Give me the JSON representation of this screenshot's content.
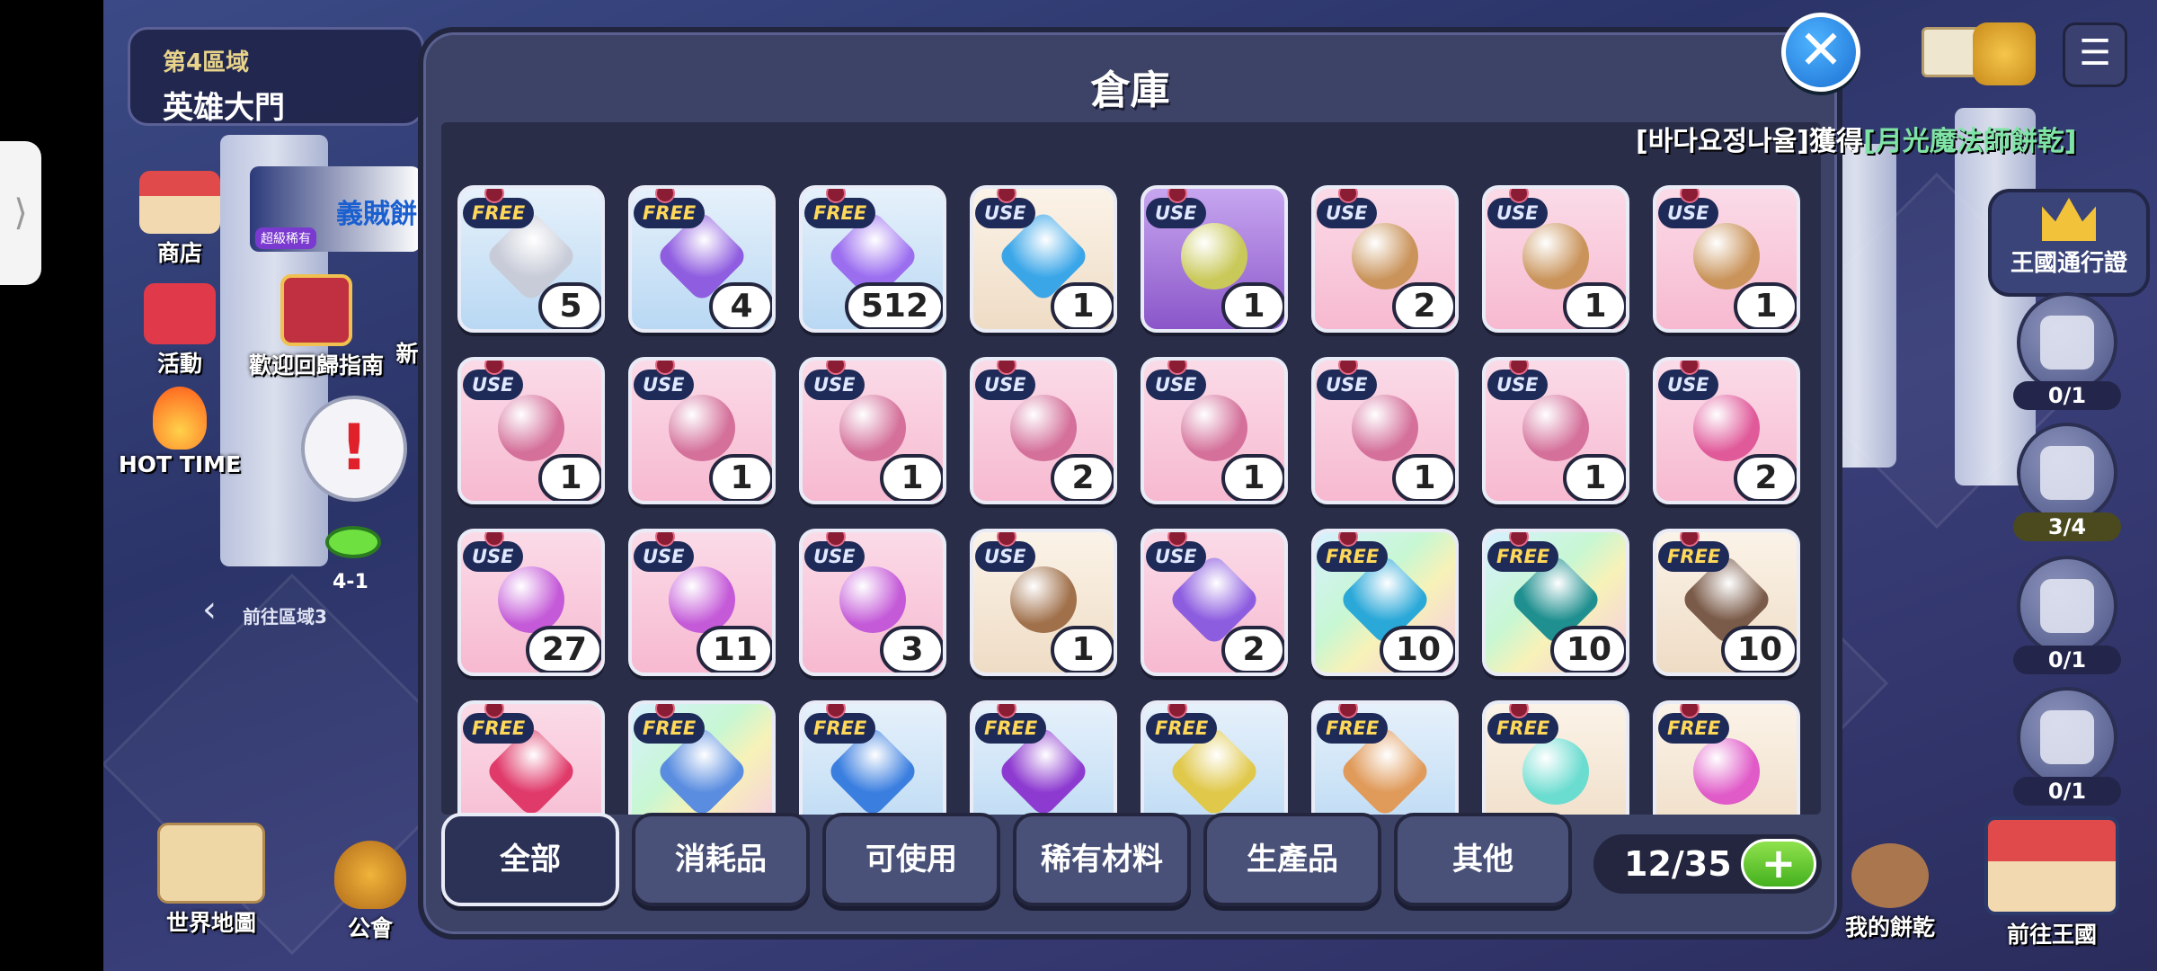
{
  "zone": {
    "subtitle": "第4區域",
    "title": "英雄大門"
  },
  "left_menu": [
    {
      "key": "shop",
      "label": "商店"
    },
    {
      "key": "event",
      "label": "活動"
    },
    {
      "key": "return_guide",
      "label": "歡迎回歸指南"
    },
    {
      "key": "hot_time",
      "label": "HOT TIME"
    }
  ],
  "banner": {
    "title": "義賊餅",
    "badge": "超級稀有"
  },
  "stage": {
    "label": "4-1",
    "prev_zone": "前往區域3",
    "partial_label": "新"
  },
  "bottom_left": {
    "world_map": "世界地圖",
    "guild": "公會"
  },
  "bottom_right": {
    "my_cookies": "我的餅乾",
    "go_kingdom": "前往王國"
  },
  "right_hud": {
    "kingdom_pass": "王國通行證",
    "counters": [
      "0/1",
      "3/4",
      "0/1",
      "0/1"
    ]
  },
  "notice": {
    "player": "[바다요정나율]",
    "verb": "獲得",
    "reward": "[月光魔法師餅乾]"
  },
  "warehouse": {
    "title": "倉庫",
    "capacity": "12/35",
    "add_label": "+",
    "close_label": "✕",
    "tabs": [
      "全部",
      "消耗品",
      "可使用",
      "稀有材料",
      "生產品",
      "其他"
    ],
    "items": [
      {
        "tag": "FREE",
        "qty": "5",
        "bg": "blue",
        "color": "#c8ccd8",
        "icon": "gingerbread-outline-icon"
      },
      {
        "tag": "FREE",
        "qty": "4",
        "bg": "blue",
        "color": "#8f5de0",
        "icon": "purple-gem-book-icon"
      },
      {
        "tag": "FREE",
        "qty": "512",
        "bg": "blue",
        "color": "#9b6ef0",
        "icon": "star-crystal-icon"
      },
      {
        "tag": "USE",
        "qty": "1",
        "bg": "cream",
        "color": "#3aa6e8",
        "icon": "level-50-star-icon"
      },
      {
        "tag": "USE",
        "qty": "1",
        "bg": "purple",
        "color": "#c9c95a",
        "icon": "legendary-chest-icon"
      },
      {
        "tag": "USE",
        "qty": "2",
        "bg": "pink",
        "color": "#c9935a",
        "icon": "cookie-chest-icon"
      },
      {
        "tag": "USE",
        "qty": "1",
        "bg": "pink",
        "color": "#c9935a",
        "icon": "cookie-chest-icon"
      },
      {
        "tag": "USE",
        "qty": "1",
        "bg": "pink",
        "color": "#c9935a",
        "icon": "cookie-chest-icon"
      },
      {
        "tag": "USE",
        "qty": "1",
        "bg": "pink",
        "color": "#d4709a",
        "icon": "cookie-chest-icon"
      },
      {
        "tag": "USE",
        "qty": "1",
        "bg": "pink",
        "color": "#d4709a",
        "icon": "cookie-chest-icon"
      },
      {
        "tag": "USE",
        "qty": "1",
        "bg": "pink",
        "color": "#d4709a",
        "icon": "cookie-chest-icon"
      },
      {
        "tag": "USE",
        "qty": "2",
        "bg": "pink",
        "color": "#d4709a",
        "icon": "cookie-chest-icon"
      },
      {
        "tag": "USE",
        "qty": "1",
        "bg": "pink",
        "color": "#d4709a",
        "icon": "cookie-chest-icon"
      },
      {
        "tag": "USE",
        "qty": "1",
        "bg": "pink",
        "color": "#d4709a",
        "icon": "cookie-chest-icon"
      },
      {
        "tag": "USE",
        "qty": "1",
        "bg": "pink",
        "color": "#d4709a",
        "icon": "cookie-chest-icon"
      },
      {
        "tag": "USE",
        "qty": "2",
        "bg": "pink",
        "color": "#e05a9a",
        "icon": "cookie-chest-icon"
      },
      {
        "tag": "USE",
        "qty": "27",
        "bg": "pink",
        "color": "#c45ad8",
        "icon": "purple-pouch-icon"
      },
      {
        "tag": "USE",
        "qty": "11",
        "bg": "pink",
        "color": "#c45ad8",
        "icon": "purple-pouch-icon"
      },
      {
        "tag": "USE",
        "qty": "3",
        "bg": "pink",
        "color": "#c45ad8",
        "icon": "purple-pouch-icon"
      },
      {
        "tag": "USE",
        "qty": "1",
        "bg": "cream",
        "color": "#a0704a",
        "icon": "brown-pouch-icon"
      },
      {
        "tag": "USE",
        "qty": "2",
        "bg": "pink",
        "color": "#8d5de0",
        "icon": "starry-card-icon"
      },
      {
        "tag": "FREE",
        "qty": "10",
        "bg": "rainbow",
        "color": "#2aa8d8",
        "icon": "water-crystal-icon"
      },
      {
        "tag": "FREE",
        "qty": "10",
        "bg": "rainbow",
        "color": "#1f8f8f",
        "icon": "emerald-crystal-icon"
      },
      {
        "tag": "FREE",
        "qty": "10",
        "bg": "cream",
        "color": "#7a5a48",
        "icon": "pendant-gem-icon"
      },
      {
        "tag": "FREE",
        "qty": "",
        "bg": "pink",
        "color": "#e03a6a",
        "icon": "red-pendant-gem-icon"
      },
      {
        "tag": "FREE",
        "qty": "",
        "bg": "rainbow",
        "color": "#5a8de0",
        "icon": "blue-pendant-gem-icon"
      },
      {
        "tag": "FREE",
        "qty": "",
        "bg": "blue",
        "color": "#3a7ee0",
        "icon": "blue-swirl-gem-icon"
      },
      {
        "tag": "FREE",
        "qty": "",
        "bg": "blue",
        "color": "#8d3ad0",
        "icon": "purple-swirl-gem-icon"
      },
      {
        "tag": "FREE",
        "qty": "",
        "bg": "blue",
        "color": "#e0c84a",
        "icon": "star-shard-icon"
      },
      {
        "tag": "FREE",
        "qty": "",
        "bg": "blue",
        "color": "#e09a5a",
        "icon": "orange-star-tile-icon"
      },
      {
        "tag": "FREE",
        "qty": "",
        "bg": "cream",
        "color": "#6adcd0",
        "icon": "mint-flower-icon"
      },
      {
        "tag": "FREE",
        "qty": "",
        "bg": "cream",
        "color": "#e05ac8",
        "icon": "color-flowers-icon"
      }
    ]
  }
}
